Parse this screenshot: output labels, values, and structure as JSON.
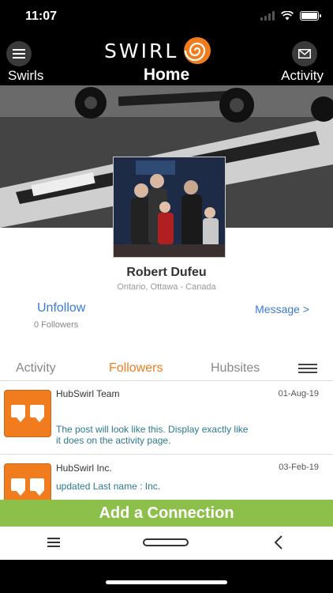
{
  "status_bar": {
    "time": "11:07"
  },
  "nav": {
    "left_label": "Swirls",
    "title": "Home",
    "right_label": "Activity",
    "logo_text": "SWIRL",
    "accent_color": "#f07c1e"
  },
  "profile": {
    "name": "Robert Dufeu",
    "location": "Ontario, Ottawa - Canada",
    "unfollow_label": "Unfollow",
    "followers_count": "0 Followers",
    "message_label": "Message >"
  },
  "tabs": [
    {
      "label": "Activity",
      "active": false
    },
    {
      "label": "Followers",
      "active": true
    },
    {
      "label": "Hubsites",
      "active": false
    }
  ],
  "feed": [
    {
      "title": "HubSwirl Team",
      "date": "01-Aug-19",
      "text": "The post will look like this. Display exactly like it does on the activity page."
    },
    {
      "title": "HubSwirl Inc.",
      "date": "03-Feb-19",
      "text": "updated Last name : Inc."
    }
  ],
  "add_connection_label": "Add a Connection",
  "icons": {
    "menu": "hamburger-icon",
    "mail": "envelope-icon",
    "logo": "swirl-spiral-icon",
    "feed": "speech-bubbles-icon",
    "tab_menu": "hamburger-icon",
    "system_back": "chevron-left-icon"
  },
  "colors": {
    "accent": "#f07c1e",
    "link": "#3a7bd5",
    "add_bar": "#8cc04a",
    "feed_text": "#2b7a8c"
  }
}
